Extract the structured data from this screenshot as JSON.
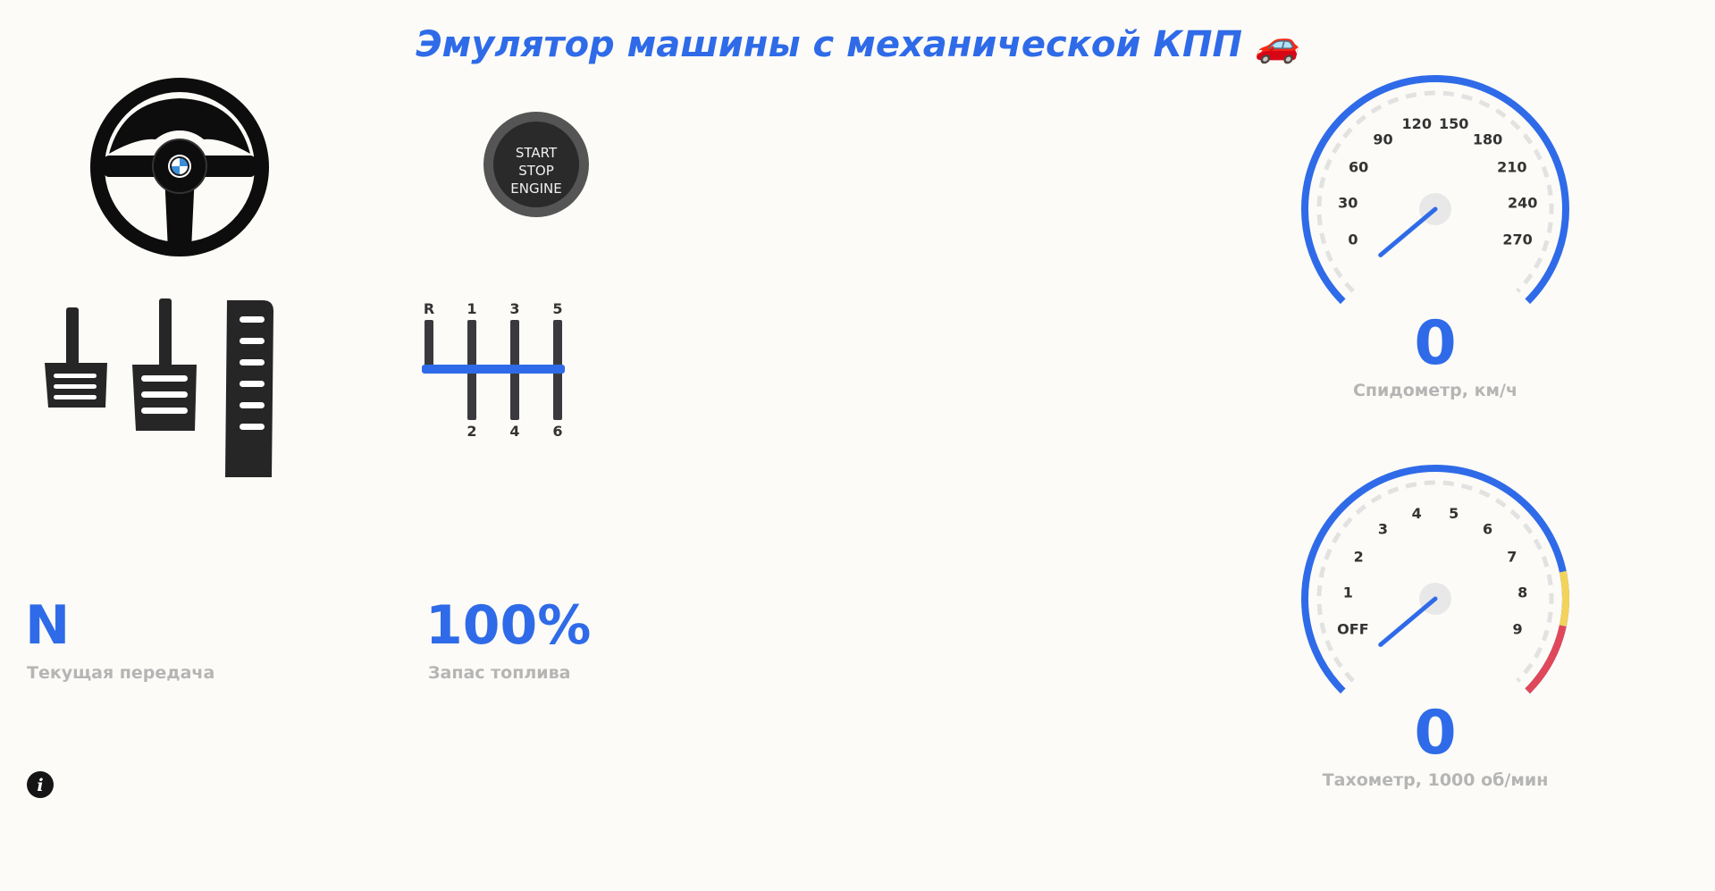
{
  "header": {
    "title": "Эмулятор машины с механической КПП 🚗"
  },
  "start_button": {
    "line1": "START",
    "line2": "STOP",
    "line3": "ENGINE"
  },
  "shifter": {
    "top_labels": [
      "R",
      "1",
      "3",
      "5"
    ],
    "bottom_labels": [
      "2",
      "4",
      "6"
    ]
  },
  "status": {
    "gear_value": "N",
    "gear_caption": "Текущая передача",
    "fuel_value": "100%",
    "fuel_caption": "Запас топлива"
  },
  "speedometer": {
    "value": "0",
    "caption": "Спидометр, км/ч",
    "ticks": [
      "0",
      "30",
      "60",
      "90",
      "120",
      "150",
      "180",
      "210",
      "240",
      "270"
    ]
  },
  "tachometer": {
    "value": "0",
    "caption": "Тахометр, 1000 об/мин",
    "ticks": [
      "OFF",
      "1",
      "2",
      "3",
      "4",
      "5",
      "6",
      "7",
      "8",
      "9"
    ]
  },
  "colors": {
    "accent": "#2f6be8",
    "warn": "#f3d35a",
    "danger": "#e0485a"
  },
  "icons": {
    "steering": "steering-wheel-icon",
    "pedals": "pedals-icon",
    "info": "info-icon"
  }
}
